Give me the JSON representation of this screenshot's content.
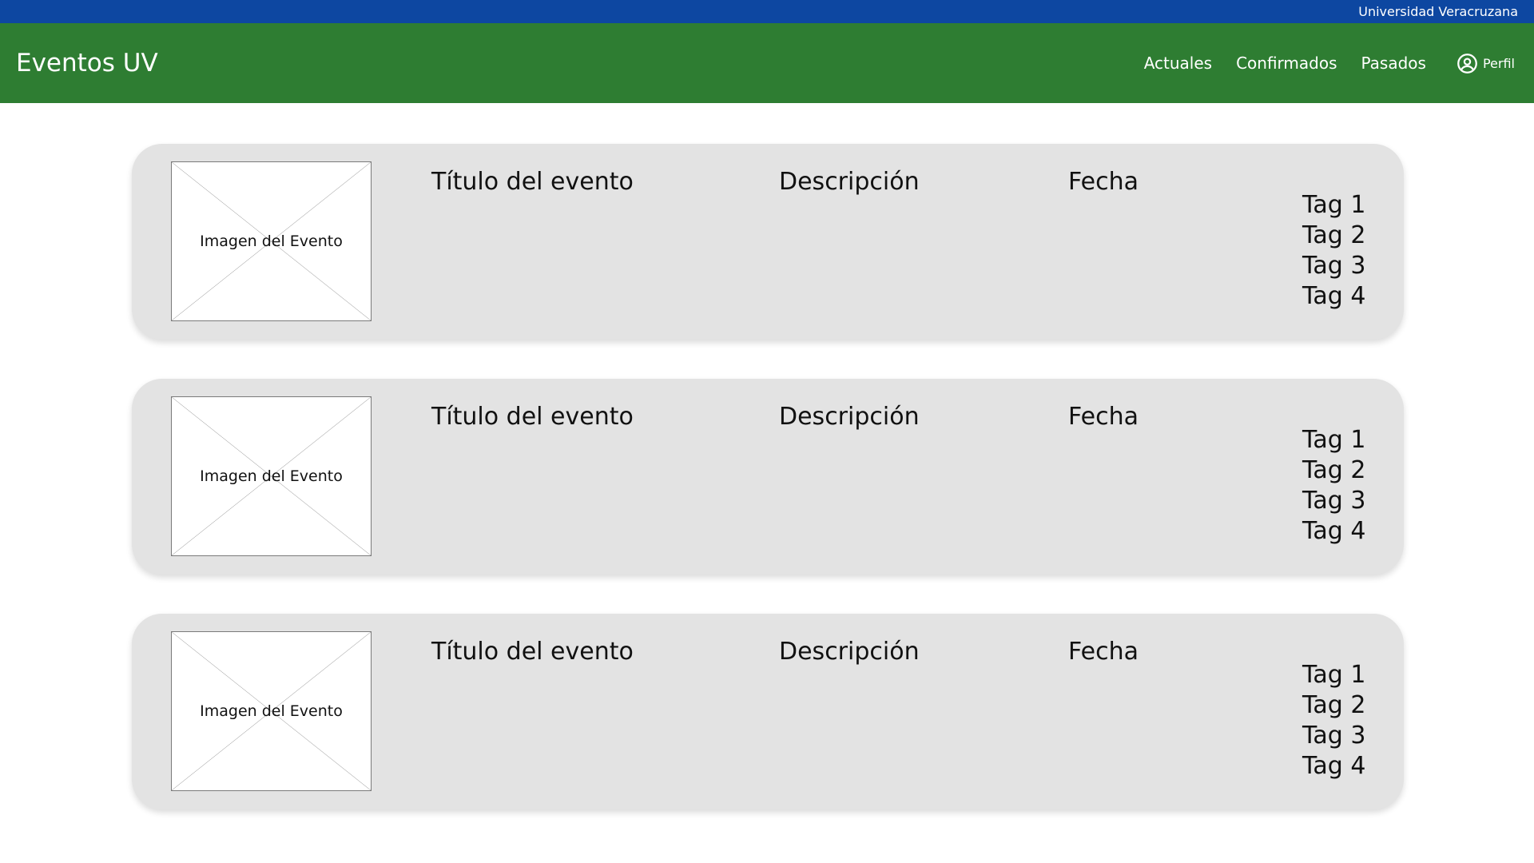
{
  "topbar": {
    "university": "Universidad Veracruzana"
  },
  "navbar": {
    "brand": "Eventos UV",
    "links": [
      "Actuales",
      "Confirmados",
      "Pasados"
    ],
    "profile_label": "Perfil",
    "profile_icon": "user-circle-icon"
  },
  "colors": {
    "topbar": "#0d47a1",
    "navbar": "#2e7d32",
    "card": "#e3e3e3"
  },
  "events": [
    {
      "image_label": "Imagen del Evento",
      "title": "Título del evento",
      "description": "Descripción",
      "date": "Fecha",
      "tags": [
        "Tag 1",
        "Tag 2",
        "Tag 3",
        "Tag 4"
      ]
    },
    {
      "image_label": "Imagen del Evento",
      "title": "Título del evento",
      "description": "Descripción",
      "date": "Fecha",
      "tags": [
        "Tag 1",
        "Tag 2",
        "Tag 3",
        "Tag 4"
      ]
    },
    {
      "image_label": "Imagen del Evento",
      "title": "Título del evento",
      "description": "Descripción",
      "date": "Fecha",
      "tags": [
        "Tag 1",
        "Tag 2",
        "Tag 3",
        "Tag 4"
      ]
    }
  ]
}
